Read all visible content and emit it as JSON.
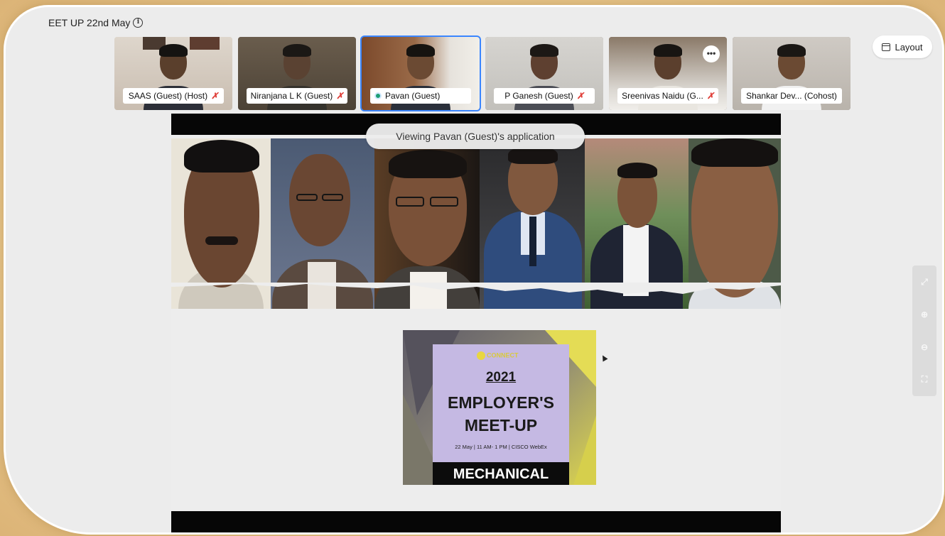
{
  "meeting": {
    "title": "EET UP 22nd May"
  },
  "participants": [
    {
      "name": "SAAS (Guest) (Host)",
      "muted": true,
      "speaking": false
    },
    {
      "name": "Niranjana L K (Guest)",
      "muted": true,
      "speaking": false
    },
    {
      "name": "Pavan (Guest)",
      "muted": false,
      "speaking": true
    },
    {
      "name": "P Ganesh (Guest)",
      "muted": true,
      "speaking": false
    },
    {
      "name": "Sreenivas Naidu (G...",
      "muted": true,
      "speaking": false,
      "has_more_menu": true
    },
    {
      "name": "Shankar Dev... (Cohost)",
      "muted": false,
      "speaking": false
    }
  ],
  "icons": {
    "info": "i",
    "mute": "✗",
    "more": "•••"
  },
  "layout_button": {
    "label": "Layout"
  },
  "share": {
    "viewing_banner": "Viewing Pavan (Guest)'s application",
    "poster": {
      "logo_text": "CONNECT",
      "year": "2021",
      "headline_line1": "EMPLOYER'S",
      "headline_line2": "MEET-UP",
      "subline": "22 May | 11 AM- 1 PM | CISCO WebEx",
      "band": "MECHANICAL"
    }
  },
  "zoom_controls": {
    "fit": "⤢",
    "zoom_in": "⊕",
    "zoom_out": "⊖",
    "fullscreen": "⛶"
  },
  "colors": {
    "active_border": "#3a86ff",
    "mute_red": "#e0403a",
    "speaking_green": "#1d9e73",
    "poster_card": "#c5b9e3"
  }
}
